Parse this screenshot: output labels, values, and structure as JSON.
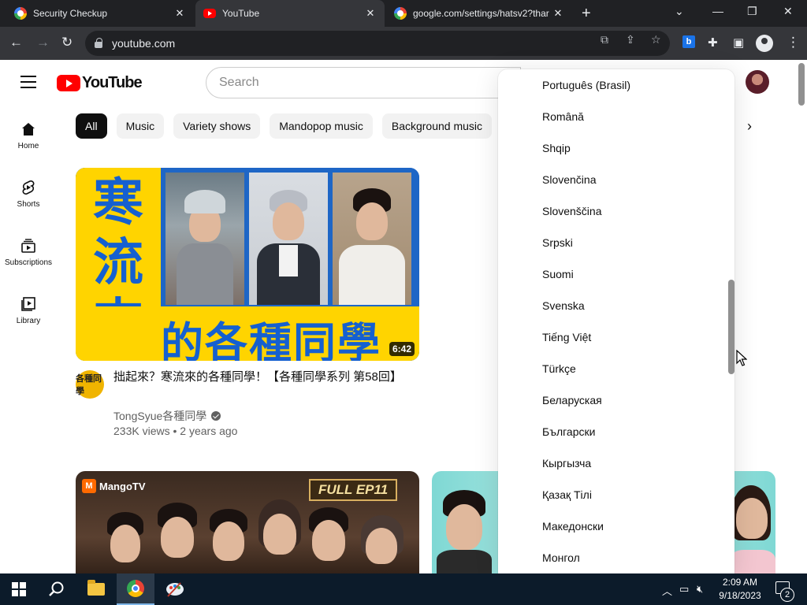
{
  "browser": {
    "tabs": [
      {
        "title": "Security Checkup"
      },
      {
        "title": "YouTube"
      },
      {
        "title": "google.com/settings/hatsv2?thar"
      }
    ],
    "address": "youtube.com",
    "extension_badge": "b"
  },
  "youtube": {
    "logo_text": "YouTube",
    "search_placeholder": "Search",
    "sidebar": [
      {
        "label": "Home",
        "icon": "home-icon"
      },
      {
        "label": "Shorts",
        "icon": "shorts-icon"
      },
      {
        "label": "Subscriptions",
        "icon": "subscriptions-icon"
      },
      {
        "label": "Library",
        "icon": "library-icon"
      }
    ],
    "chips": [
      "All",
      "Music",
      "Variety shows",
      "Mandopop music",
      "Background music"
    ],
    "video1": {
      "thumb_side_text": [
        "寒",
        "流",
        "來"
      ],
      "thumb_band_text": "的各種同學",
      "duration": "6:42",
      "channel_avatar_text": "各種同學",
      "title": "拙起來？寒流來的各種同學！【各種同學系列 第58回】",
      "channel": "TongSyue各種同學",
      "views": "233K views",
      "age": "2 years ago"
    },
    "video2": {
      "brand": "MangoTV",
      "brand_mark": "M",
      "badge": "FULL EP11"
    }
  },
  "language_menu": {
    "items": [
      "Português (Brasil)",
      "Română",
      "Shqip",
      "Slovenčina",
      "Slovenščina",
      "Srpski",
      "Suomi",
      "Svenska",
      "Tiếng Việt",
      "Türkçe",
      "Беларуская",
      "Български",
      "Кыргызча",
      "Қазақ Тілі",
      "Македонски",
      "Монгол"
    ]
  },
  "taskbar": {
    "time": "2:09 AM",
    "date": "9/18/2023",
    "notifications": "2"
  }
}
